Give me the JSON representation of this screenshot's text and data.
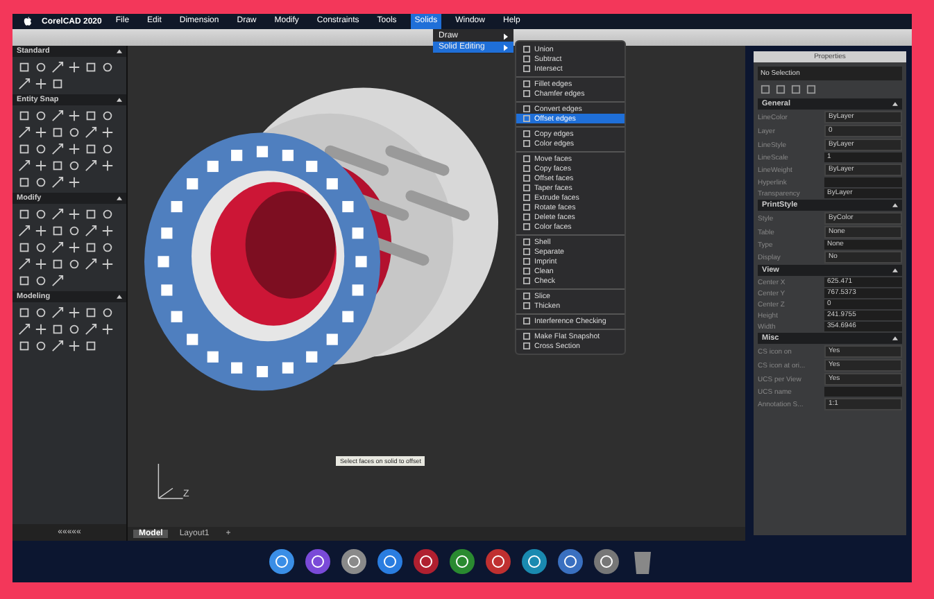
{
  "menu_bar": {
    "app_name": "CorelCAD 2020",
    "menus": [
      {
        "label": "File",
        "selected": false
      },
      {
        "label": "Edit",
        "selected": false
      },
      {
        "label": "Dimension",
        "selected": false
      },
      {
        "label": "Draw",
        "selected": false
      },
      {
        "label": "Modify",
        "selected": false
      },
      {
        "label": "Constraints",
        "selected": false
      },
      {
        "label": "Tools",
        "selected": false
      },
      {
        "label": "Solids",
        "selected": true
      },
      {
        "label": "Window",
        "selected": false
      },
      {
        "label": "Help",
        "selected": false
      }
    ]
  },
  "solids_menu": [
    {
      "label": "Draw",
      "selected": false
    },
    {
      "label": "Solid Editing",
      "selected": true
    }
  ],
  "solid_editing_menu": [
    [
      {
        "label": "Union",
        "selected": false
      },
      {
        "label": "Subtract",
        "selected": false
      },
      {
        "label": "Intersect",
        "selected": false
      }
    ],
    [
      {
        "label": "Fillet edges",
        "selected": false
      },
      {
        "label": "Chamfer edges",
        "selected": false
      }
    ],
    [
      {
        "label": "Convert edges",
        "selected": false
      },
      {
        "label": "Offset edges",
        "selected": true
      }
    ],
    [
      {
        "label": "Copy edges",
        "selected": false
      },
      {
        "label": "Color edges",
        "selected": false
      }
    ],
    [
      {
        "label": "Move faces",
        "selected": false
      },
      {
        "label": "Copy faces",
        "selected": false
      },
      {
        "label": "Offset faces",
        "selected": false
      },
      {
        "label": "Taper faces",
        "selected": false
      },
      {
        "label": "Extrude faces",
        "selected": false
      },
      {
        "label": "Rotate faces",
        "selected": false
      },
      {
        "label": "Delete faces",
        "selected": false
      },
      {
        "label": "Color faces",
        "selected": false
      }
    ],
    [
      {
        "label": "Shell",
        "selected": false
      },
      {
        "label": "Separate",
        "selected": false
      },
      {
        "label": "Imprint",
        "selected": false
      },
      {
        "label": "Clean",
        "selected": false
      },
      {
        "label": "Check",
        "selected": false
      }
    ],
    [
      {
        "label": "Slice",
        "selected": false
      },
      {
        "label": "Thicken",
        "selected": false
      }
    ],
    [
      {
        "label": "Interference Checking",
        "selected": false
      }
    ],
    [
      {
        "label": "Make Flat Snapshot",
        "selected": false
      },
      {
        "label": "Cross Section",
        "selected": false
      }
    ]
  ],
  "left_panel": {
    "sections": [
      "Standard",
      "Entity Snap",
      "Modify",
      "Modeling"
    ],
    "collapse_label": "«««««"
  },
  "canvas": {
    "tooltip": "Select faces on solid to offset",
    "axis_label": "Z"
  },
  "layout_tabs": [
    {
      "label": "Model",
      "selected": true
    },
    {
      "label": "Layout1",
      "selected": false
    },
    {
      "label": "+",
      "selected": false
    }
  ],
  "properties": {
    "title": "Properties",
    "selection": "No Selection",
    "sections": [
      {
        "title": "General",
        "rows": [
          {
            "label": "LineColor",
            "value": "ByLayer",
            "kind": "dropdown"
          },
          {
            "label": "Layer",
            "value": "0",
            "kind": "dropdown"
          },
          {
            "label": "LineStyle",
            "value": "ByLayer",
            "kind": "dropdown"
          },
          {
            "label": "LineScale",
            "value": "1",
            "kind": "text"
          },
          {
            "label": "LineWeight",
            "value": "ByLayer",
            "kind": "dropdown"
          },
          {
            "label": "Hyperlink",
            "value": "",
            "kind": "text"
          },
          {
            "label": "Transparency",
            "value": "ByLayer",
            "kind": "text"
          }
        ]
      },
      {
        "title": "PrintStyle",
        "rows": [
          {
            "label": "Style",
            "value": "ByColor",
            "kind": "dropdown"
          },
          {
            "label": "Table",
            "value": "None",
            "kind": "dropdown"
          },
          {
            "label": "Type",
            "value": "None",
            "kind": "text"
          },
          {
            "label": "Display",
            "value": "No",
            "kind": "dropdown"
          }
        ]
      },
      {
        "title": "View",
        "rows": [
          {
            "label": "Center X",
            "value": "625.471",
            "kind": "text"
          },
          {
            "label": "Center Y",
            "value": "767.5373",
            "kind": "text"
          },
          {
            "label": "Center Z",
            "value": "0",
            "kind": "text"
          },
          {
            "label": "Height",
            "value": "241.9755",
            "kind": "text"
          },
          {
            "label": "Width",
            "value": "354.6946",
            "kind": "text"
          }
        ]
      },
      {
        "title": "Misc",
        "rows": [
          {
            "label": "CS icon on",
            "value": "Yes",
            "kind": "dropdown"
          },
          {
            "label": "CS icon at ori...",
            "value": "Yes",
            "kind": "dropdown"
          },
          {
            "label": "UCS per View",
            "value": "Yes",
            "kind": "dropdown"
          },
          {
            "label": "UCS name",
            "value": "",
            "kind": "text"
          },
          {
            "label": "Annotation S...",
            "value": "1:1",
            "kind": "dropdown"
          }
        ]
      }
    ]
  }
}
